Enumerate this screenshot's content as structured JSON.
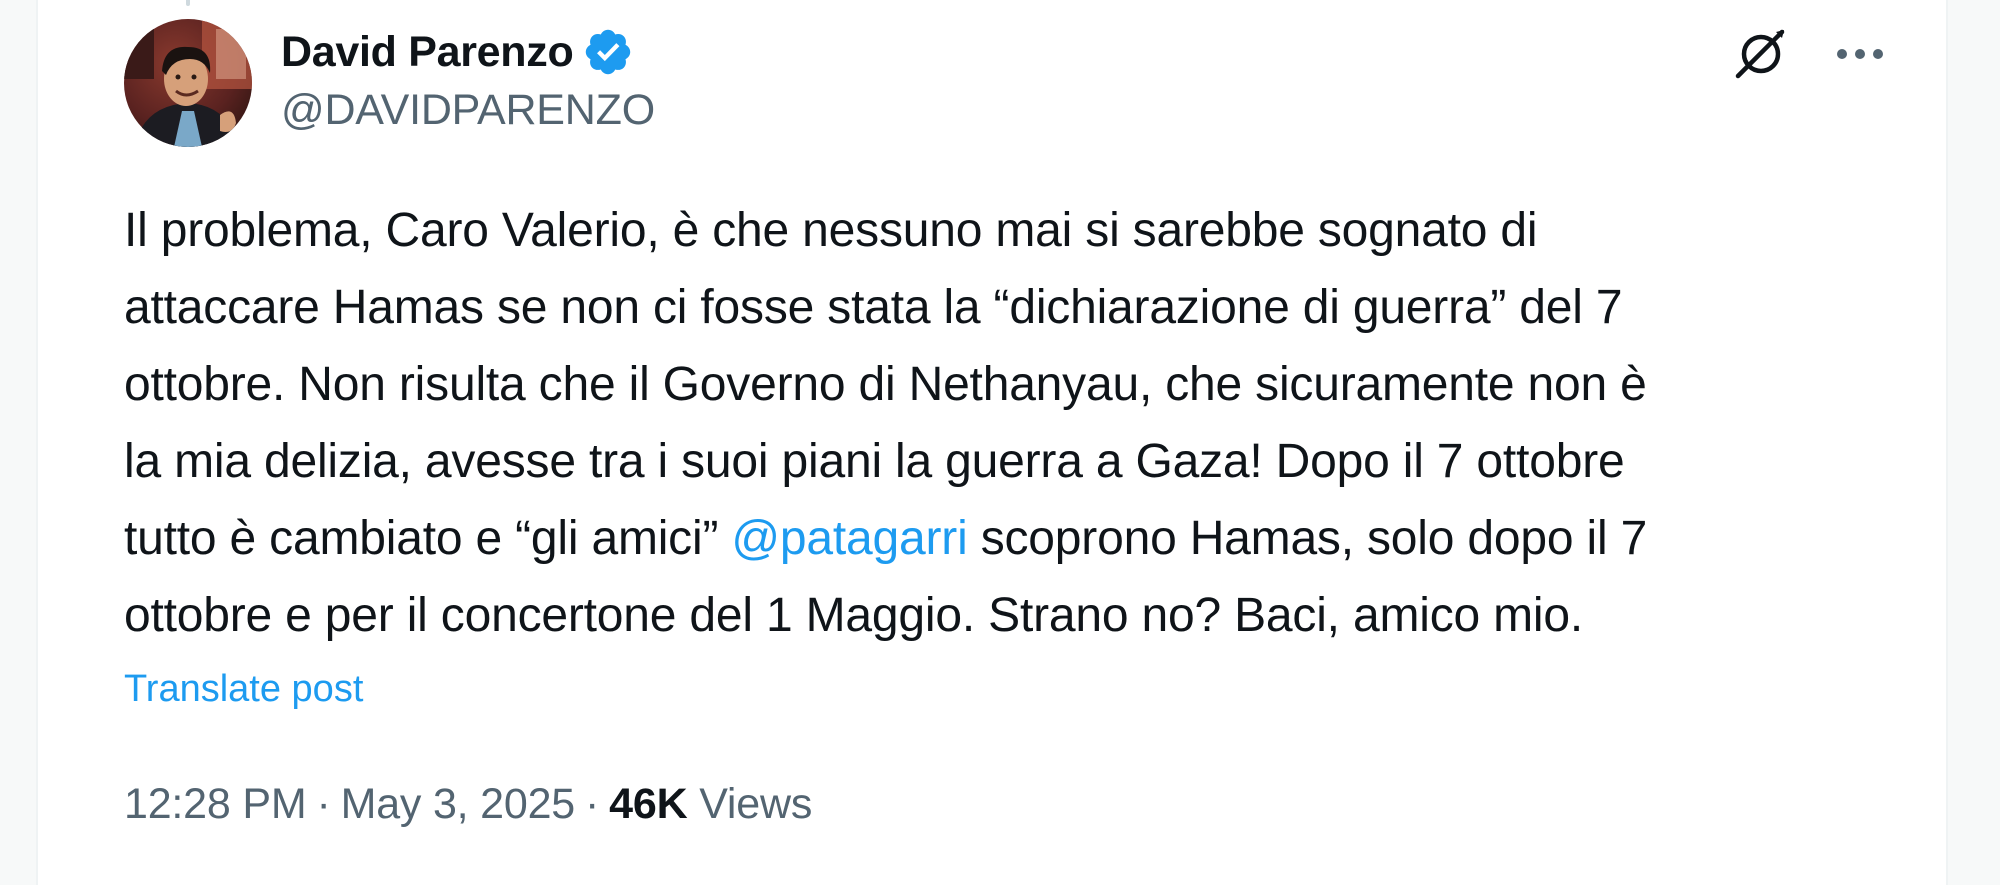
{
  "author": {
    "display_name": "David Parenzo",
    "handle": "@DAVIDPARENZO",
    "verified": true,
    "avatar_icon": "profile-photo"
  },
  "post": {
    "lines": [
      {
        "text": "Il problema, Caro Valerio, è che nessuno mai si sarebbe sognato di"
      },
      {
        "text": "attaccare Hamas se non ci fosse stata la “dichiarazione di guerra” del 7"
      },
      {
        "text": "ottobre. Non risulta che il Governo di Nethanyau, che sicuramente  non è"
      },
      {
        "text": "la mia delizia, avesse tra i suoi piani la guerra a Gaza! Dopo il 7 ottobre"
      },
      {
        "before": "tutto è cambiato e “gli amici” ",
        "mention": "@patagarri",
        "after": " scoprono Hamas, solo dopo il 7"
      },
      {
        "text": "ottobre e per il concertone del 1 Maggio. Strano no? Baci, amico mio."
      }
    ],
    "translate_label": "Translate post"
  },
  "meta": {
    "time": "12:28 PM",
    "separator": "·",
    "date": "May 3, 2025",
    "views_count": "46K",
    "views_label": "Views"
  },
  "icons": {
    "grok": "grok-icon",
    "more": "more-icon",
    "verified": "verified-badge-icon"
  },
  "colors": {
    "text": "#0f1419",
    "secondary": "#536471",
    "accent": "#1d9bf0"
  }
}
